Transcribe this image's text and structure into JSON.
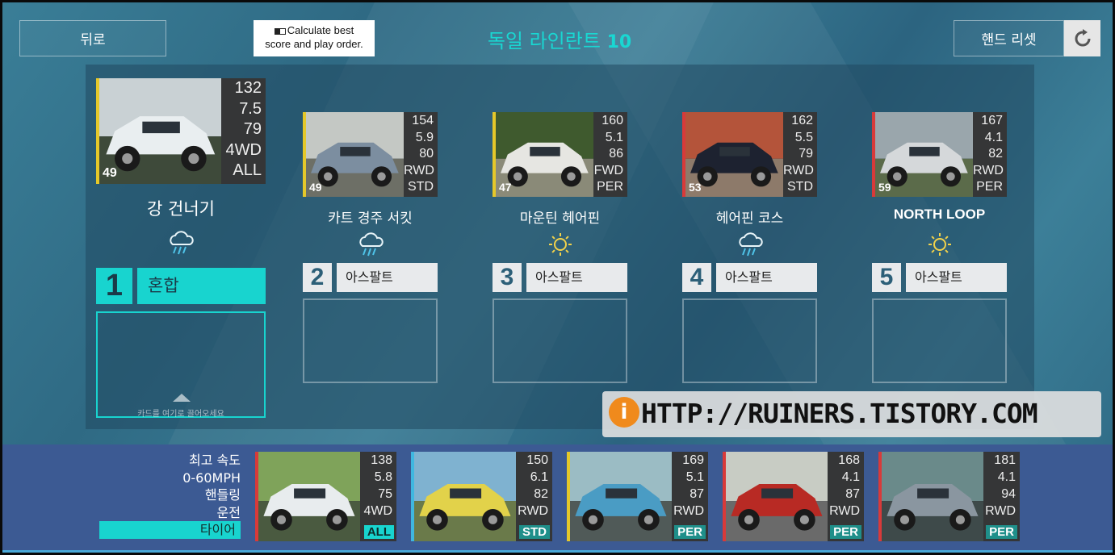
{
  "header": {
    "back_label": "뒤로",
    "calc_label_1": "Calculate best",
    "calc_label_2": "score and play order.",
    "title_text": "독일 라인란트",
    "title_num": "10",
    "hand_reset_label": "핸드 리셋"
  },
  "events": [
    {
      "name": "강 건너기",
      "weather": "rain",
      "slot": "1",
      "surface": "혼합",
      "active": true,
      "car": {
        "rating": "49",
        "stats": [
          "132",
          "7.5",
          "79",
          "4WD",
          "ALL"
        ],
        "stripe": "#e5c82a",
        "palette": [
          "#c9d1d4",
          "#e9eef0",
          "#3e4a3a"
        ]
      }
    },
    {
      "name": "카트 경주 서킷",
      "weather": "rain",
      "slot": "2",
      "surface": "아스팔트",
      "active": false,
      "car": {
        "rating": "49",
        "stats": [
          "154",
          "5.9",
          "80",
          "RWD",
          "STD"
        ],
        "stripe": "#e5c82a",
        "palette": [
          "#c4c8c4",
          "#7c8ea0",
          "#6d6f66"
        ]
      }
    },
    {
      "name": "마운틴 헤어핀",
      "weather": "sun",
      "slot": "3",
      "surface": "아스팔트",
      "active": false,
      "car": {
        "rating": "47",
        "stats": [
          "160",
          "5.1",
          "86",
          "FWD",
          "PER"
        ],
        "stripe": "#e5c82a",
        "palette": [
          "#3f5a2e",
          "#e6e6e2",
          "#8a8a78"
        ]
      }
    },
    {
      "name": "헤어핀 코스",
      "weather": "rain",
      "slot": "4",
      "surface": "아스팔트",
      "active": false,
      "car": {
        "rating": "53",
        "stats": [
          "162",
          "5.5",
          "79",
          "RWD",
          "STD"
        ],
        "stripe": "#d83a3a",
        "palette": [
          "#b4543a",
          "#1d2230",
          "#8d7a6a"
        ]
      }
    },
    {
      "name": "NORTH LOOP",
      "weather": "sun",
      "slot": "5",
      "surface": "아스팔트",
      "active": false,
      "car": {
        "rating": "59",
        "stats": [
          "167",
          "4.1",
          "82",
          "RWD",
          "PER"
        ],
        "stripe": "#d83a3a",
        "palette": [
          "#9aa6ac",
          "#d5d8da",
          "#5b6b4a"
        ]
      }
    }
  ],
  "drop_hint": "카드를 여기로 끌어오세요",
  "legend": [
    "최고 속도",
    "0-60MPH",
    "핸들링",
    "운전",
    "타이어"
  ],
  "hand": [
    {
      "stats": [
        "138",
        "5.8",
        "75",
        "4WD"
      ],
      "badge": "ALL",
      "stripe": "#d83a3a",
      "palette": [
        "#7fa35a",
        "#e8ecee",
        "#4a5a40"
      ]
    },
    {
      "stats": [
        "150",
        "6.1",
        "82",
        "RWD"
      ],
      "badge": "STD",
      "stripe": "#3fb7e0",
      "palette": [
        "#7fb2d0",
        "#e2d24a",
        "#6a7a4a"
      ]
    },
    {
      "stats": [
        "169",
        "5.1",
        "87",
        "RWD"
      ],
      "badge": "PER",
      "stripe": "#e5c82a",
      "palette": [
        "#9bbcc4",
        "#4a9cc4",
        "#505a58"
      ]
    },
    {
      "stats": [
        "168",
        "4.1",
        "87",
        "RWD"
      ],
      "badge": "PER",
      "stripe": "#d83a3a",
      "palette": [
        "#c8ccc4",
        "#b82a24",
        "#6a6a6a"
      ]
    },
    {
      "stats": [
        "181",
        "4.1",
        "94",
        "RWD"
      ],
      "badge": "PER",
      "stripe": "#d83a3a",
      "palette": [
        "#6a8a8a",
        "#8a96a0",
        "#3e4a4a"
      ]
    }
  ],
  "watermark": "HTTP://RUINERS.TISTORY.COM",
  "colors": {
    "accent": "#19d7d2",
    "badge_all": "#18d4cf",
    "badge": "#1f8f8a"
  }
}
